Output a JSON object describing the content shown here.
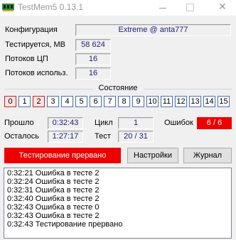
{
  "window": {
    "title": "TestMem5  0.13.1",
    "close_glyph": "✕"
  },
  "config": {
    "label": "Конфигурация",
    "value": "Extreme @ anta777"
  },
  "info": {
    "tested_label": "Тестируется, MB",
    "tested_value": "58 624",
    "cpu_threads_label": "Потоков ЦП",
    "cpu_threads_value": "16",
    "threads_used_label": "Потоков использ.",
    "threads_used_value": "16"
  },
  "state": {
    "title": "Состояние",
    "cells": [
      {
        "label": "0",
        "error": true
      },
      {
        "label": "1",
        "error": false
      },
      {
        "label": "2",
        "error": true
      },
      {
        "label": "3",
        "error": false
      },
      {
        "label": "4",
        "error": false
      },
      {
        "label": "5",
        "error": false
      },
      {
        "label": "6",
        "error": false
      },
      {
        "label": "7",
        "error": false
      },
      {
        "label": "8",
        "error": false
      },
      {
        "label": "9",
        "error": false
      },
      {
        "label": "10",
        "error": false
      },
      {
        "label": "11",
        "error": false
      },
      {
        "label": "12",
        "error": false
      },
      {
        "label": "13",
        "error": false
      },
      {
        "label": "14",
        "error": false
      },
      {
        "label": "15",
        "error": false
      }
    ]
  },
  "stats": {
    "elapsed_label": "Прошло",
    "elapsed_value": "0:32:43",
    "remaining_label": "Осталось",
    "remaining_value": "1:27:17",
    "cycle_label": "Цикл",
    "cycle_value": "1",
    "test_label": "Тест",
    "test_value": "20 / 31",
    "errors_label": "Ошибок",
    "errors_value": "6 / 6"
  },
  "actions": {
    "status": "Тестирование прервано",
    "settings": "Настройки",
    "journal": "Журнал"
  },
  "log": [
    "0:32:21  Ошибка в тесте 2",
    "0:32:24  Ошибка в тесте 2",
    "0:32:31  Ошибка в тесте 2",
    "0:32:40  Ошибка в тесте 2",
    "0:32:43  Ошибка в тесте 0",
    "0:32:43  Ошибка в тесте 2",
    "0:32:43  Тестирование прервано"
  ],
  "colors": {
    "error_red": "#ee0000",
    "cell_border": "#4a74b5",
    "cell_error_border": "#d32020",
    "value_text": "#1c1c7a"
  }
}
